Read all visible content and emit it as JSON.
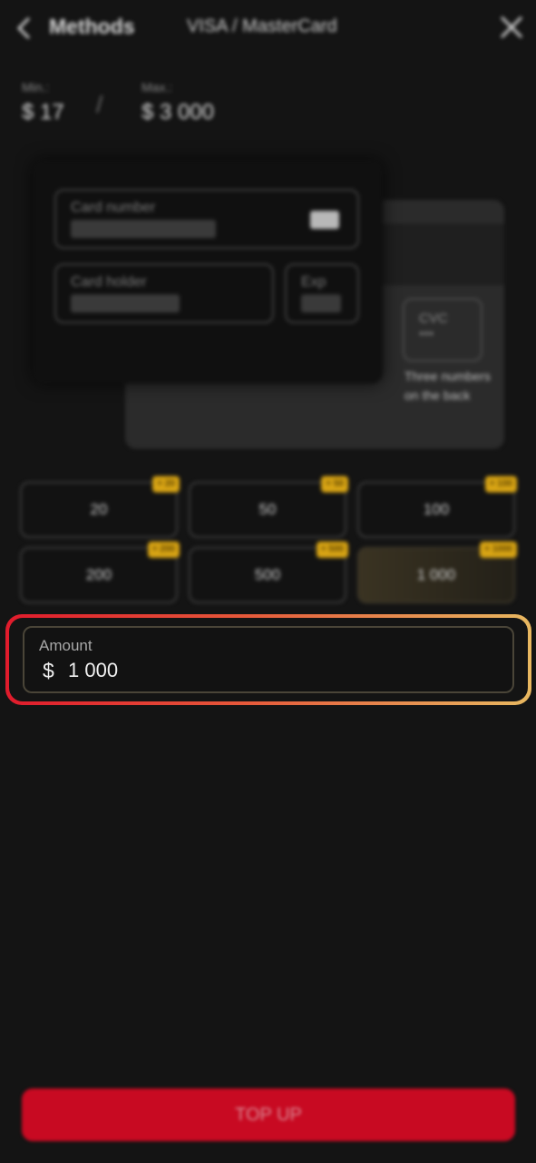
{
  "header": {
    "back_icon": "chevron-left-icon",
    "title": "Methods",
    "method": "VISA / MasterCard",
    "close_icon": "close-icon"
  },
  "limits": {
    "min_label": "Min.:",
    "min_value": "$ 17",
    "separator": "/",
    "max_label": "Max.:",
    "max_value": "$ 3 000"
  },
  "card": {
    "number_label": "Card number",
    "holder_label": "Card holder",
    "exp_label": "Exp",
    "cvc_label": "CVC",
    "cvc_value": "***",
    "cvc_hint": "Three numbers on the back"
  },
  "amounts": [
    {
      "value": "20",
      "bonus": "+ 20"
    },
    {
      "value": "50",
      "bonus": "+ 50"
    },
    {
      "value": "100",
      "bonus": "+ 100"
    },
    {
      "value": "200",
      "bonus": "+ 200"
    },
    {
      "value": "500",
      "bonus": "+ 500"
    },
    {
      "value": "1 000",
      "bonus": "+ 1000"
    }
  ],
  "selected_amount_index": 5,
  "amount_field": {
    "label": "Amount",
    "currency": "$",
    "value": "1 000"
  },
  "topup_button": "TOP UP",
  "colors": {
    "accent": "#c80a22",
    "badge": "#d9a514",
    "highlight_start": "#e01b2c",
    "highlight_end": "#e8b860"
  }
}
